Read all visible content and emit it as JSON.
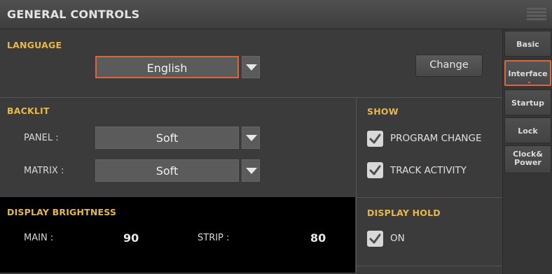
{
  "header": {
    "title": "GENERAL CONTROLS",
    "menu_icon": "hamburger-menu-icon"
  },
  "language": {
    "section_title": "LANGUAGE",
    "selected": "English",
    "change_label": "Change"
  },
  "backlit": {
    "section_title": "BACKLIT",
    "panel_label": "PANEL :",
    "panel_value": "Soft",
    "matrix_label": "MATRIX :",
    "matrix_value": "Soft"
  },
  "show": {
    "section_title": "SHOW",
    "items": [
      {
        "label": "PROGRAM CHANGE",
        "checked": true
      },
      {
        "label": "TRACK ACTIVITY",
        "checked": true
      }
    ]
  },
  "display_brightness": {
    "section_title": "DISPLAY BRIGHTNESS",
    "main_label": "MAIN :",
    "main_value": "90",
    "strip_label": "STRIP :",
    "strip_value": "80"
  },
  "display_hold": {
    "section_title": "DISPLAY HOLD",
    "on_label": "ON",
    "checked": true
  },
  "tabs": [
    {
      "label": "Basic",
      "active": false
    },
    {
      "label": "Interface",
      "active": true
    },
    {
      "label": "Startup",
      "active": false
    },
    {
      "label": "Lock",
      "active": false
    },
    {
      "label_line1": "Clock&",
      "label_line2": "Power",
      "active": false
    }
  ],
  "colors": {
    "accent": "#d9673c",
    "section_title": "#e6b84c",
    "background": "#3b3b3b"
  }
}
